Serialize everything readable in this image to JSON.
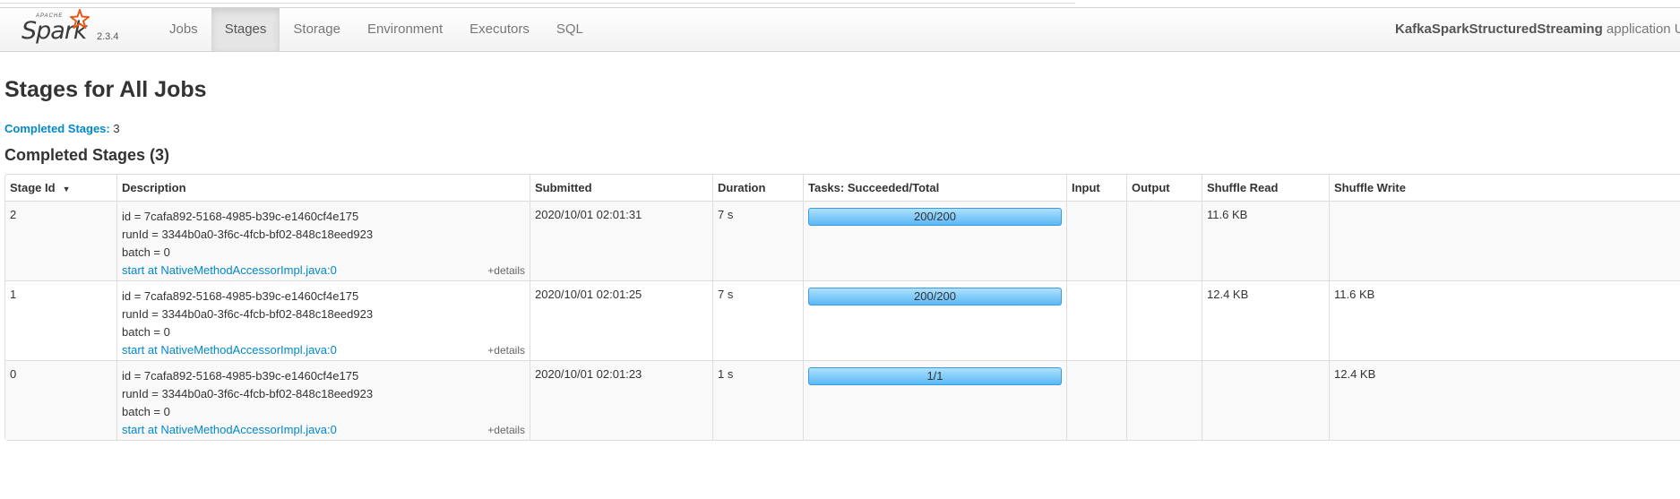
{
  "app": {
    "brand_small": "APACHE",
    "brand": "Spark",
    "version": "2.3.4",
    "name_bold": "KafkaSparkStructuredStreaming",
    "name_suffix": " application U"
  },
  "nav": {
    "jobs": "Jobs",
    "stages": "Stages",
    "storage": "Storage",
    "environment": "Environment",
    "executors": "Executors",
    "sql": "SQL",
    "active": "Stages"
  },
  "page": {
    "title": "Stages for All Jobs",
    "completed_link": "Completed Stages:",
    "completed_count": "3",
    "section_title": "Completed Stages (3)"
  },
  "table": {
    "headers": {
      "stage_id": "Stage Id",
      "description": "Description",
      "submitted": "Submitted",
      "duration": "Duration",
      "tasks": "Tasks: Succeeded/Total",
      "input": "Input",
      "output": "Output",
      "shuffle_read": "Shuffle Read",
      "shuffle_write": "Shuffle Write"
    },
    "sort_indicator": "▼",
    "rows": [
      {
        "stage_id": "2",
        "desc_id": "id = 7cafa892-5168-4985-b39c-e1460cf4e175",
        "desc_runid": "runId = 3344b0a0-3f6c-4fcb-bf02-848c18eed923",
        "desc_batch": "batch = 0",
        "desc_link": "start at NativeMethodAccessorImpl.java:0",
        "details": "+details",
        "submitted": "2020/10/01 02:01:31",
        "duration": "7 s",
        "tasks": "200/200",
        "tasks_fraction": 1.0,
        "input": "",
        "output": "",
        "shuffle_read": "11.6 KB",
        "shuffle_write": ""
      },
      {
        "stage_id": "1",
        "desc_id": "id = 7cafa892-5168-4985-b39c-e1460cf4e175",
        "desc_runid": "runId = 3344b0a0-3f6c-4fcb-bf02-848c18eed923",
        "desc_batch": "batch = 0",
        "desc_link": "start at NativeMethodAccessorImpl.java:0",
        "details": "+details",
        "submitted": "2020/10/01 02:01:25",
        "duration": "7 s",
        "tasks": "200/200",
        "tasks_fraction": 1.0,
        "input": "",
        "output": "",
        "shuffle_read": "12.4 KB",
        "shuffle_write": "11.6 KB"
      },
      {
        "stage_id": "0",
        "desc_id": "id = 7cafa892-5168-4985-b39c-e1460cf4e175",
        "desc_runid": "runId = 3344b0a0-3f6c-4fcb-bf02-848c18eed923",
        "desc_batch": "batch = 0",
        "desc_link": "start at NativeMethodAccessorImpl.java:0",
        "details": "+details",
        "submitted": "2020/10/01 02:01:23",
        "duration": "1 s",
        "tasks": "1/1",
        "tasks_fraction": 1.0,
        "input": "",
        "output": "",
        "shuffle_read": "",
        "shuffle_write": "12.4 KB"
      }
    ]
  },
  "colors": {
    "link": "#0088cc",
    "progress_fill": "#5ab8f5",
    "active_tab_bg": "#e5e5e5"
  }
}
